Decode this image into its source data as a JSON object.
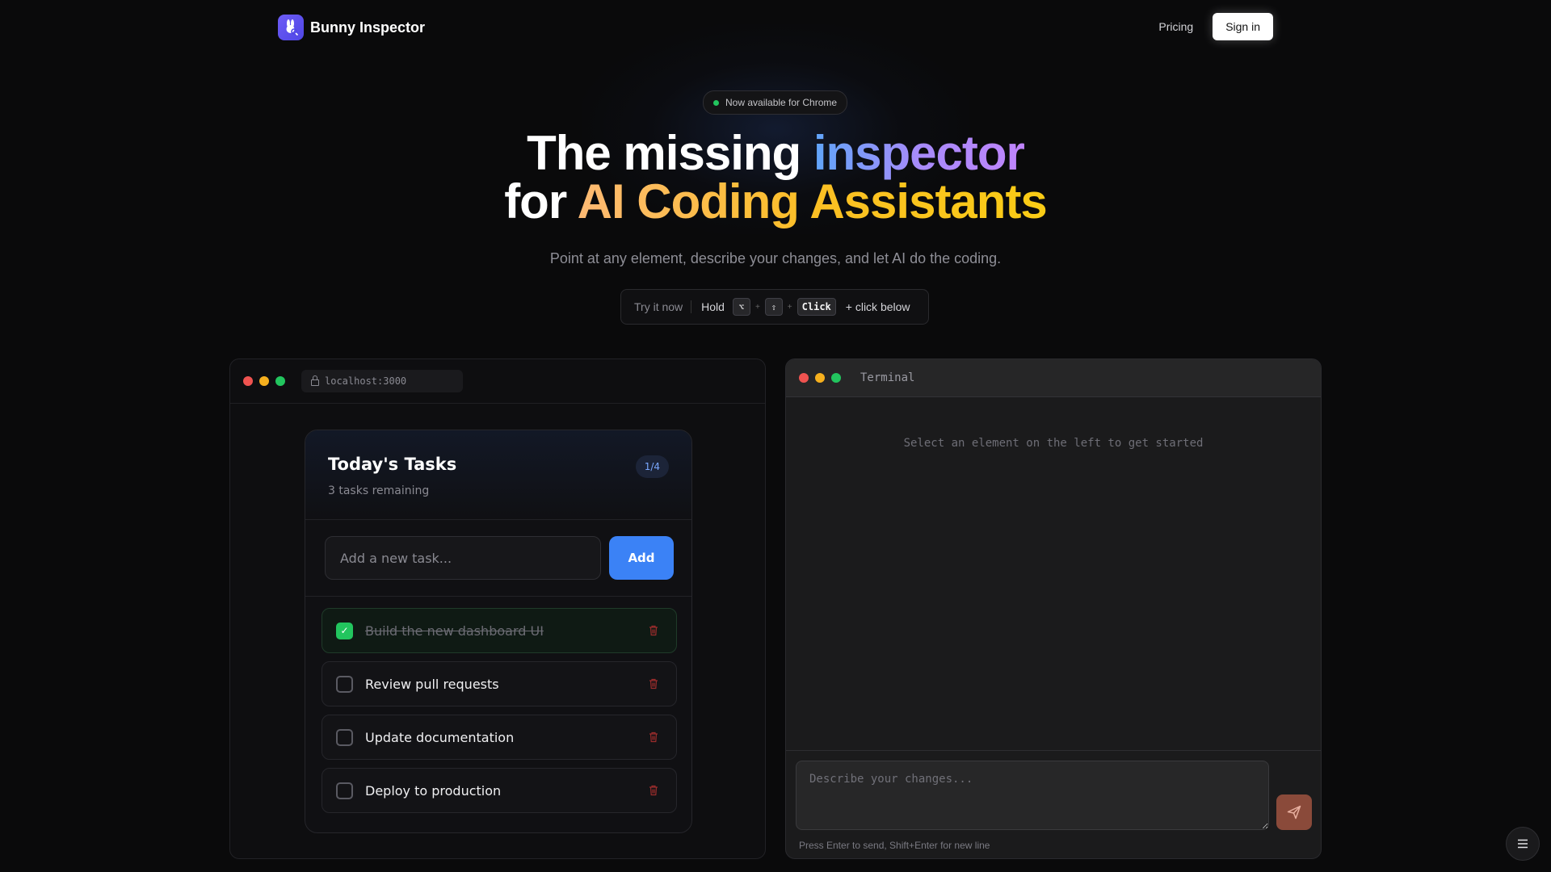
{
  "nav": {
    "brand": "Bunny Inspector",
    "pricing": "Pricing",
    "signin": "Sign in"
  },
  "hero": {
    "badge": "Now available for Chrome",
    "title_line1_plain": "The missing ",
    "title_line1_accent": "inspector",
    "title_line2_plain": "for ",
    "title_line2_accent": "AI Coding Assistants",
    "subtitle": "Point at any element, describe your changes, and let AI do the coding.",
    "try": {
      "label": "Try it now",
      "hold": "Hold",
      "keys": [
        "⌥",
        "⇧",
        "Click"
      ],
      "plus": "+",
      "suffix": "+ click below"
    }
  },
  "browser": {
    "url": "localhost:3000"
  },
  "tasks": {
    "title": "Today's Tasks",
    "remaining": "3 tasks remaining",
    "count": "1/4",
    "input_placeholder": "Add a new task...",
    "add_label": "Add",
    "items": [
      {
        "text": "Build the new dashboard UI",
        "done": true
      },
      {
        "text": "Review pull requests",
        "done": false
      },
      {
        "text": "Update documentation",
        "done": false
      },
      {
        "text": "Deploy to production",
        "done": false
      }
    ]
  },
  "terminal": {
    "title": "Terminal",
    "hint": "Select an element on the left to get started",
    "input_placeholder": "Describe your changes...",
    "note": "Press Enter to send, Shift+Enter for new line"
  },
  "colors": {
    "accent_blue": "#3b82f6",
    "success_green": "#22c55e",
    "danger_red": "#ef4444",
    "send_button": "#8a4a3a"
  },
  "icons": {
    "logo": "bunny-icon",
    "lock": "lock-icon",
    "trash": "trash-icon",
    "send": "send-icon",
    "menu": "menu-icon"
  }
}
